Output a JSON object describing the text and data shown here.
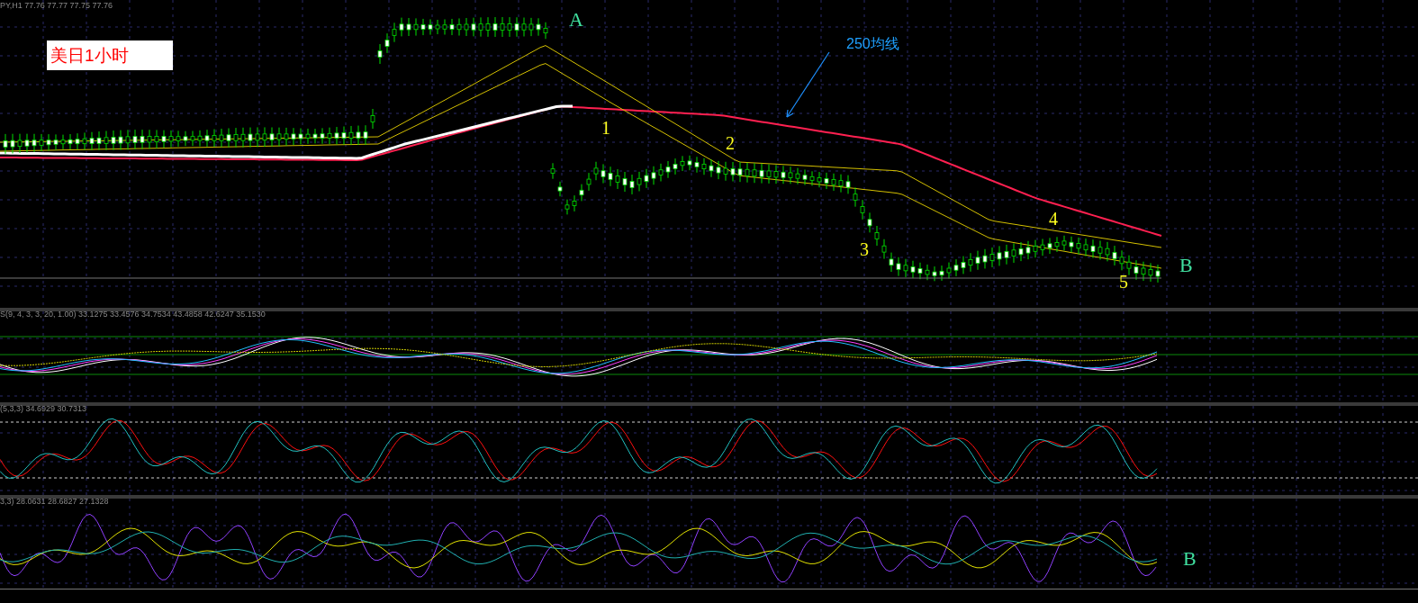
{
  "price_panel": {
    "header": "PY,H1  77.76 77.77 77.75 77.76",
    "title_label": "美日1小时",
    "ma_label": "250均线",
    "markers": [
      {
        "text": "A",
        "kind": "letter"
      },
      {
        "text": "1",
        "kind": "wave"
      },
      {
        "text": "2",
        "kind": "wave"
      },
      {
        "text": "3",
        "kind": "wave"
      },
      {
        "text": "4",
        "kind": "wave"
      },
      {
        "text": "5",
        "kind": "wave"
      },
      {
        "text": "B",
        "kind": "letter"
      }
    ]
  },
  "indicators": [
    {
      "label": "S(9, 4, 3, 3, 20, 1.00) 33.1275 33.4576 34.7534 43.4858 42.6247 35.1530"
    },
    {
      "label": "(5,3,3) 34.6929 30.7313"
    },
    {
      "label": "3,3) 28.0631 28.6827 27.1328",
      "marker": "B"
    }
  ]
}
